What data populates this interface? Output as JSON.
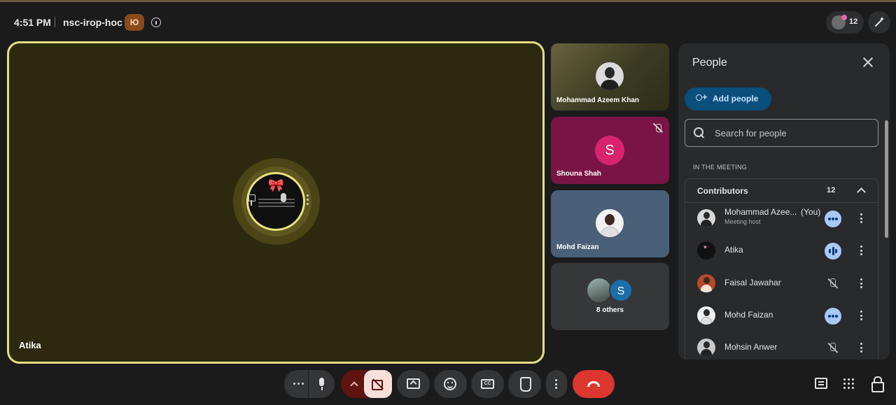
{
  "header": {
    "time": "4:51 PM",
    "meeting_code": "nsc-irop-hoc",
    "host_badge": "Ю",
    "participant_count": "12"
  },
  "stage": {
    "main_speaker": "Atika",
    "tiles": [
      {
        "name": "Mohammad Azeem Khan"
      },
      {
        "name": "Shouna Shah",
        "initial": "S"
      },
      {
        "name": "Mohd Faizan"
      },
      {
        "label": "8 others",
        "initial": "S"
      }
    ]
  },
  "people_panel": {
    "title": "People",
    "add_label": "Add people",
    "search_placeholder": "Search for people",
    "section_label": "IN THE MEETING",
    "group_label": "Contributors",
    "group_count": "12",
    "participants": [
      {
        "name": "Mohammad Azee...",
        "you": "(You)",
        "role": "Meeting host",
        "status": "active"
      },
      {
        "name": "Atika",
        "status": "speaking"
      },
      {
        "name": "Faisal Jawahar",
        "status": "muted"
      },
      {
        "name": "Mohd Faizan",
        "status": "active"
      },
      {
        "name": "Mohsin Anwer",
        "status": "muted"
      }
    ]
  },
  "colors": {
    "active_speaker_border": "#e4de86",
    "leave_button": "#dc362e",
    "camera_off": "#f9dedc",
    "accent_button": "#0b4f7c"
  }
}
